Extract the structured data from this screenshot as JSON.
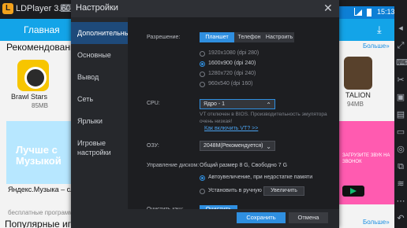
{
  "emulator": {
    "logo_letter": "L",
    "title": "LDPlayer 3.60",
    "gamepad_icon": "gamepad-icon",
    "status_time": "15:13"
  },
  "android": {
    "header_title": "Главная",
    "recommended": "Рекомендованны",
    "app1_name": "Brawl Stars",
    "app1_size": "85MB",
    "banner_text": "Лучше с Музыкой",
    "banner_caption": "Яндекс.Музыка – слуш",
    "banner_sub": "бесплатные программы",
    "popular": "Популярные игры",
    "right_more_top": "Больше»",
    "right_app_name": "TALION",
    "right_app_size": "94MB",
    "music_text": "ЗАГРУЗИТЕ ЗВУК НА ЗВОНОК",
    "right_more_bottom": "Больше»"
  },
  "dialog": {
    "title": "Настройки",
    "close_glyph": "✕",
    "nav": [
      {
        "label": "Дополнительные",
        "active": true
      },
      {
        "label": "Основные"
      },
      {
        "label": "Вывод"
      },
      {
        "label": "Сеть"
      },
      {
        "label": "Ярлыки"
      },
      {
        "label": "Игровые настройки"
      }
    ],
    "resolution": {
      "label": "Разрешение:",
      "tabs": [
        "Планшет",
        "Телефон",
        "Настроить"
      ],
      "active_tab": "Планшет",
      "options": [
        "1920x1080  (dpi 280)",
        "1600x900  (dpi 240)",
        "1280x720  (dpi 240)",
        "960x540  (dpi 160)"
      ],
      "selected_index": 1
    },
    "cpu": {
      "label": "CPU:",
      "value": "Ядро - 1",
      "hint": "VT отключен в BIOS. Производительность эмулятора очень низкая!",
      "link": "Как включить VT? >>"
    },
    "ram": {
      "label": "ОЗУ:",
      "value": "2048M(Рекомендуется)"
    },
    "disk": {
      "label": "Управление диском:",
      "info": "Общий размер 8 G,  Свободно 7 G",
      "opt1": "Автоувеличение, при недостатке памяти",
      "opt2": "Установить в ручную",
      "increase_button": "Увеличить"
    },
    "cache": {
      "label": "Очистить кэш:",
      "button": "Очистить"
    },
    "save_button": "Сохранить",
    "cancel_button": "Отмена"
  },
  "colors": {
    "accent": "#2f8fe0",
    "android_blue": "#13a4e8"
  }
}
